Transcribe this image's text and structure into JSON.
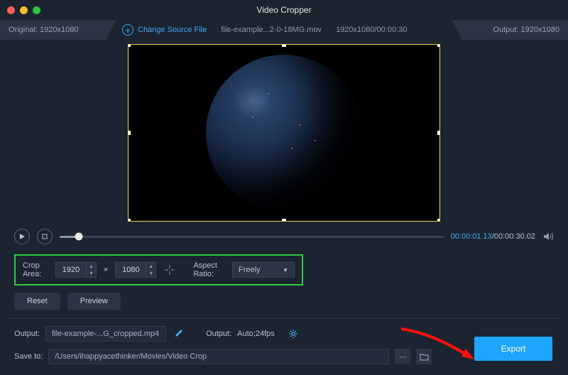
{
  "window": {
    "title": "Video Cropper"
  },
  "traffic": {
    "close": "#ff5f57",
    "min": "#febc2e",
    "max": "#28c840"
  },
  "header": {
    "original_label": "Original: 1920x1080",
    "change_source": "Change Source File",
    "file_name": "file-example...2-0-18MG.mov",
    "file_meta": "1920x1080/00:00:30",
    "output_label": "Output: 1920x1080"
  },
  "playback": {
    "current": "00:00:01.13",
    "total": "00:00:30.02"
  },
  "crop": {
    "area_label": "Crop Area:",
    "width": "1920",
    "times": "×",
    "height": "1080",
    "aspect_label": "Aspect Ratio:",
    "aspect_value": "Freely"
  },
  "buttons": {
    "reset": "Reset",
    "preview": "Preview",
    "export": "Export"
  },
  "output": {
    "label1": "Output:",
    "file": "file-example-...G_cropped.mp4",
    "label2": "Output:",
    "format": "Auto;24fps",
    "save_label": "Save to:",
    "save_path": "/Users/ihappyacethinker/Movies/Video Crop"
  }
}
